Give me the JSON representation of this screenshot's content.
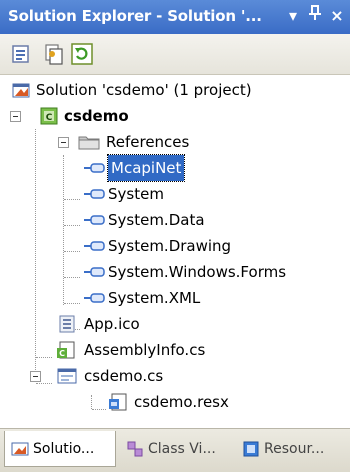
{
  "window": {
    "title": "Solution Explorer - Solution '... ▾ ᵖ ×",
    "title_text": "Solution Explorer - Solution '...",
    "dropdown_glyph": "▾",
    "pin_glyph": "ᵖ",
    "close_glyph": "×"
  },
  "toolbar": {
    "buttons": [
      "properties-icon",
      "show-all-files-icon",
      "refresh-icon"
    ]
  },
  "tree": {
    "solution": "Solution 'csdemo' (1 project)",
    "project": "csdemo",
    "references_folder": "References",
    "references": [
      "McapiNet",
      "System",
      "System.Data",
      "System.Drawing",
      "System.Windows.Forms",
      "System.XML"
    ],
    "selected_reference": "McapiNet",
    "files": [
      "App.ico",
      "AssemblyInfo.cs",
      "csdemo.cs"
    ],
    "csdemo_child": "csdemo.resx"
  },
  "tabs": [
    {
      "label": "Solutio...",
      "active": true
    },
    {
      "label": "Class Vi...",
      "active": false
    },
    {
      "label": "Resour...",
      "active": false
    }
  ]
}
